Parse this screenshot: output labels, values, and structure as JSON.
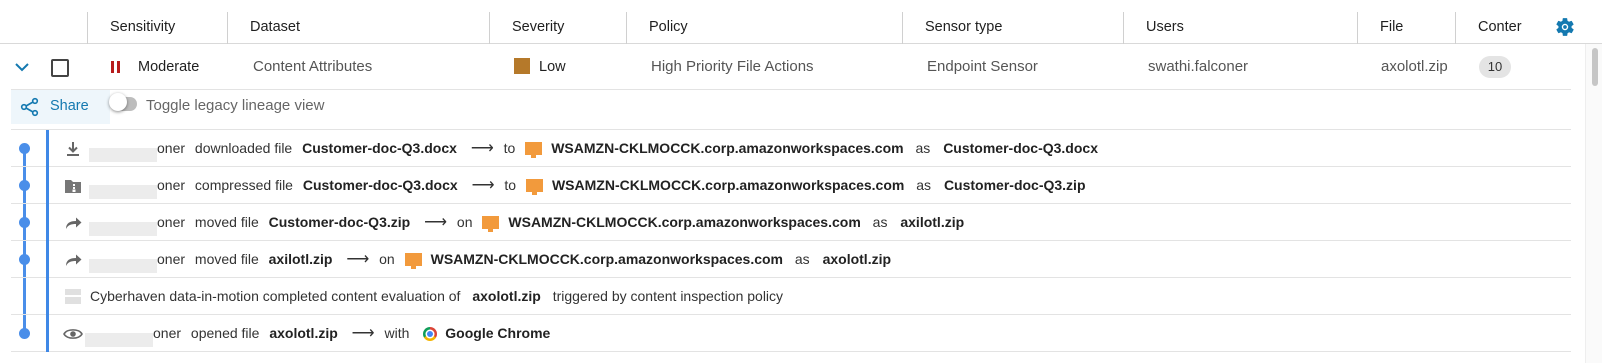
{
  "columns": [
    "Sensitivity",
    "Dataset",
    "Severity",
    "Policy",
    "Sensor type",
    "Users",
    "File",
    "Conter"
  ],
  "row": {
    "sensitivity": "Moderate",
    "dataset": "Content Attributes",
    "severity": "Low",
    "policy": "High Priority File Actions",
    "sensor_type": "Endpoint Sensor",
    "user": "swathi.falconer",
    "file": "axolotl.zip",
    "content_count": "10",
    "colors": {
      "sensitivity": "#b71c1c",
      "severity": "#b5792a"
    }
  },
  "toolbar": {
    "share_label": "Share",
    "toggle_label": "Toggle legacy lineage view"
  },
  "events": [
    {
      "icon": "download-icon",
      "user": "oner",
      "action": "downloaded file",
      "file": "Customer-doc-Q3.docx",
      "prep": "to",
      "host": "WSAMZN-CKLMOCCK.corp.amazonworkspaces.com",
      "as_label": "as",
      "result": "Customer-doc-Q3.docx"
    },
    {
      "icon": "zip-folder-icon",
      "user": "oner",
      "action": "compressed file",
      "file": "Customer-doc-Q3.docx",
      "prep": "to",
      "host": "WSAMZN-CKLMOCCK.corp.amazonworkspaces.com",
      "as_label": "as",
      "result": "Customer-doc-Q3.zip"
    },
    {
      "icon": "move-arrow-icon",
      "user": "oner",
      "action": "moved file",
      "file": "Customer-doc-Q3.zip",
      "prep": "on",
      "host": "WSAMZN-CKLMOCCK.corp.amazonworkspaces.com",
      "as_label": "as",
      "result": "axilotl.zip"
    },
    {
      "icon": "move-arrow-icon",
      "user": "oner",
      "action": "moved file",
      "file": "axilotl.zip",
      "prep": "on",
      "host": "WSAMZN-CKLMOCCK.corp.amazonworkspaces.com",
      "as_label": "as",
      "result": "axolotl.zip"
    },
    {
      "icon": "evaluation-icon",
      "text_before": "Cyberhaven data-in-motion completed content evaluation of",
      "file": "axolotl.zip",
      "text_after": "triggered by content inspection policy"
    },
    {
      "icon": "eye-icon",
      "user": "oner",
      "action": "opened file",
      "file": "axolotl.zip",
      "prep": "with",
      "app": "Google Chrome"
    }
  ]
}
